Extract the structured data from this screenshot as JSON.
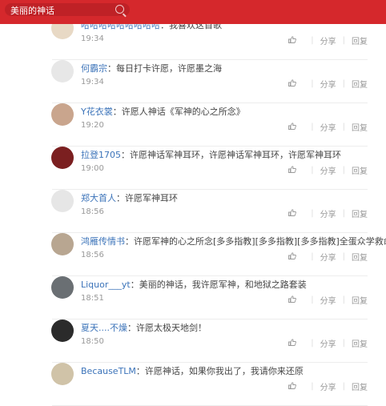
{
  "search": {
    "value": "美丽的神话"
  },
  "comments": [
    {
      "user": "哈哈哈哈哈哈哈哈哈",
      "sep": "：",
      "text": "我喜欢这首歌",
      "time": "19:34",
      "avatar_bg": "#e8d9c5"
    },
    {
      "user": "何霸宗",
      "sep": "：",
      "text": "每日打卡许愿，许愿墨之海",
      "time": "19:34",
      "avatar_bg": "#e7e7e7"
    },
    {
      "user": "Y花衣裳",
      "sep": "：",
      "text": "许愿人神话《军神的心之所念》",
      "time": "19:20",
      "avatar_bg": "#c9a58d"
    },
    {
      "user": "拉登1705",
      "sep": "：",
      "text": "许愿神话军神耳环，许愿神话军神耳环，许愿军神耳环",
      "time": "19:00",
      "avatar_bg": "#7b1f20"
    },
    {
      "user": "郑大首人",
      "sep": "：",
      "text": "许愿军神耳环",
      "time": "18:56",
      "avatar_bg": "#e6e6e6"
    },
    {
      "user": "鸿雁传情书",
      "sep": "：",
      "text": "许愿军神的心之所念[多多指教][多多指教][多多指教]全蛋众学救命",
      "time": "18:56",
      "avatar_bg": "#b8a691"
    },
    {
      "user": "Liquor___yt",
      "sep": "：",
      "text": "美丽的神话，我许愿军神，和地狱之路套装",
      "time": "18:51",
      "avatar_bg": "#6a6f73"
    },
    {
      "user": "夏天....不燥",
      "sep": "：",
      "text": "许愿太极天地剑！",
      "time": "18:50",
      "avatar_bg": "#2b2b2b"
    },
    {
      "user": "BecauseTLM",
      "sep": "：",
      "text": "许愿神话，如果你我出了，我请你来还原",
      "time": "",
      "avatar_bg": "#d0c3a8"
    }
  ],
  "actions": {
    "share": "分享",
    "reply": "回复",
    "divider": "|"
  }
}
